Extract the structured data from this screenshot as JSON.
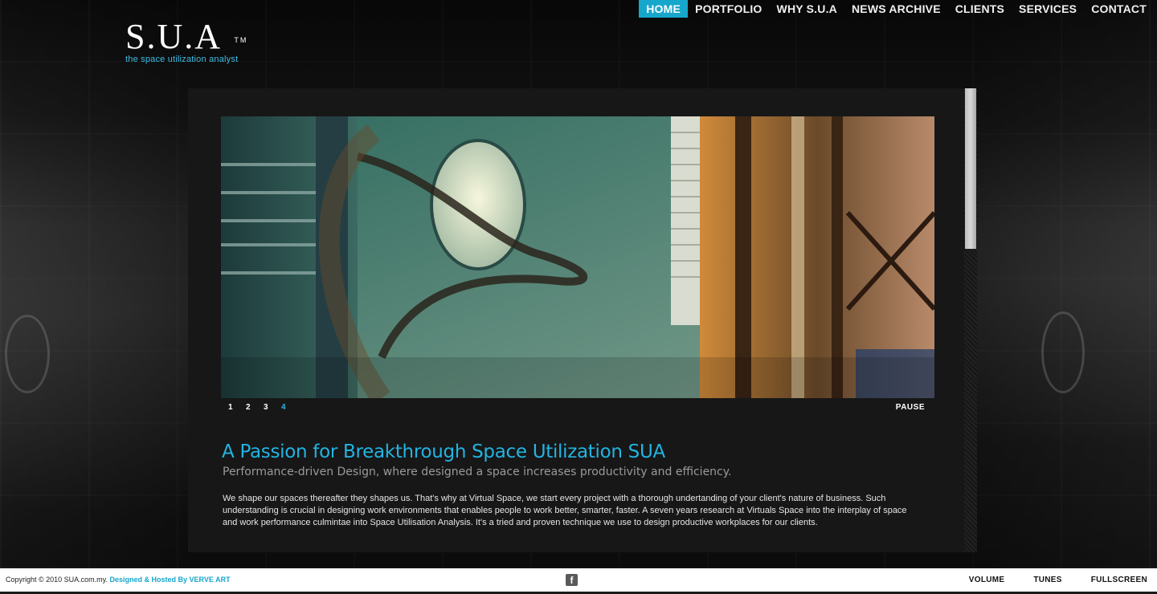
{
  "nav": {
    "items": [
      {
        "label": "HOME",
        "active": true
      },
      {
        "label": "PORTFOLIO"
      },
      {
        "label": "WHY S.U.A"
      },
      {
        "label": "NEWS ARCHIVE"
      },
      {
        "label": "CLIENTS"
      },
      {
        "label": "SERVICES"
      },
      {
        "label": "CONTACT"
      }
    ]
  },
  "logo": {
    "mark": "S.U.A",
    "trademark": "TM",
    "tagline": "the space utilization analyst"
  },
  "slideshow": {
    "pages": [
      "1",
      "2",
      "3",
      "4"
    ],
    "current_page": "4",
    "pause_label": "PAUSE"
  },
  "content": {
    "headline": "A Passion for Breakthrough Space Utilization SUA",
    "subhead": "Performance-driven Design, where designed a space increases productivity and efficiency.",
    "body": "We shape our spaces thereafter they shapes us. That's why at Virtual Space, we start every project with a thorough undertanding of your client's nature of business. Such understanding is crucial in designing work environments that enables people to work better, smarter, faster. A seven years research at Virtuals Space into the interplay of space and work performance culmintae into Space Utilisation Analysis. It's a tried and proven technique we use to design productive workplaces for our clients."
  },
  "footer": {
    "copyright": "Copyright © 2010 SUA.com.my.",
    "credit": "Designed & Hosted By VERVE ART",
    "social_icon": "facebook-icon",
    "controls": [
      "VOLUME",
      "TUNES",
      "FULLSCREEN"
    ]
  },
  "colors": {
    "accent": "#17a6cc",
    "headline": "#22b4e2",
    "panel": "#171717",
    "footer_bg": "#ffffff"
  }
}
